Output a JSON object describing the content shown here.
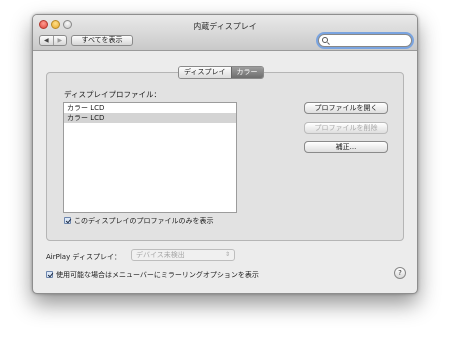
{
  "window": {
    "title": "内蔵ディスプレイ"
  },
  "toolbar": {
    "back_icon": "◀",
    "forward_icon": "▶",
    "show_all_label": "すべてを表示",
    "search_value": ""
  },
  "tabs": [
    {
      "label": "ディスプレイ",
      "selected": false
    },
    {
      "label": "カラー",
      "selected": true
    }
  ],
  "color_pane": {
    "profile_title": "ディスプレイプロファイル：",
    "profiles": [
      {
        "label": "カラー LCD",
        "selected": false
      },
      {
        "label": "カラー LCD",
        "selected": true
      }
    ],
    "open_profile_label": "プロファイルを開く",
    "delete_profile_label": "プロファイルを削除",
    "calibrate_label": "補正...",
    "show_only_label": "このディスプレイのプロファイルのみを表示",
    "show_only_checked": true
  },
  "airplay": {
    "label": "AirPlay ディスプレイ：",
    "selected_value": "デバイス未検出",
    "arrows_icon": "⇕"
  },
  "mirroring": {
    "label": "使用可能な場合はメニューバーにミラーリングオプションを表示",
    "checked": true
  },
  "help_label": "?",
  "colors": {
    "selected_row": "#d4d4d4",
    "search_focus": "#7aa4e0",
    "selected_tab": "#6e6e6e"
  }
}
